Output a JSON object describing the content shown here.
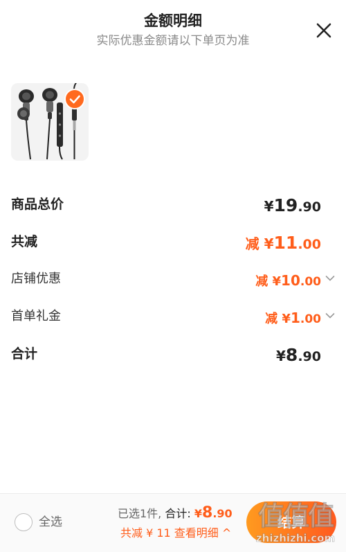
{
  "header": {
    "title": "金额明细",
    "subtitle": "实际优惠金额请以下单页为准",
    "close_icon": "close-icon"
  },
  "product": {
    "image_icon": "earphones-image",
    "selected": true
  },
  "rows": {
    "total": {
      "label": "商品总价",
      "currency": "¥",
      "integer": "19",
      "decimal": ".90"
    },
    "reduction": {
      "label": "共减",
      "prefix": "减 ¥",
      "integer": "11",
      "decimal": ".00"
    },
    "store_discount": {
      "label": "店铺优惠",
      "prefix": "减 ¥",
      "integer": "10",
      "decimal": ".00"
    },
    "first_order": {
      "label": "首单礼金",
      "prefix": "减 ¥",
      "integer": "1",
      "decimal": ".00"
    },
    "subtotal": {
      "label": "合计",
      "currency": "¥",
      "integer": "8",
      "decimal": ".90"
    }
  },
  "footer": {
    "select_all": "全选",
    "selected_count": "已选1件,",
    "total_label": "合计:",
    "total_currency": "¥",
    "total_integer": "8",
    "total_decimal": ".90",
    "detail_link": "共减 ¥ 11 查看明细 ^",
    "checkout": "结算",
    "watermark_glyphs": "值值值",
    "watermark_url": "zhizhizhi.com"
  },
  "colors": {
    "accent": "#ff5d1a",
    "checkout_start": "#ff9a1f",
    "checkout_end": "#ff5a1f"
  }
}
